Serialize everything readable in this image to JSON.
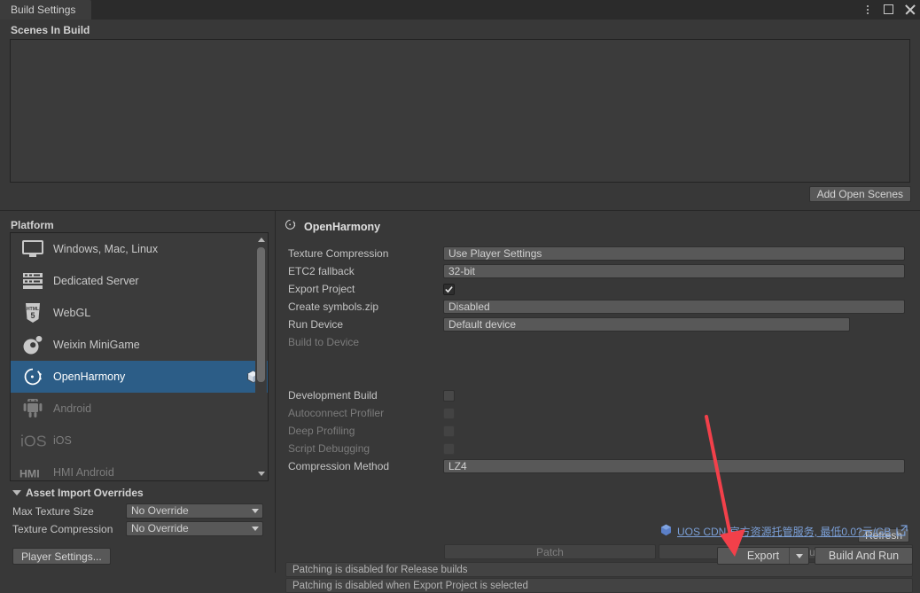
{
  "window": {
    "tab_label": "Build Settings",
    "menu_icon": "kebab-menu-icon",
    "maximize_icon": "maximize-icon",
    "close_icon": "close-icon"
  },
  "scenes": {
    "title": "Scenes In Build",
    "items": [],
    "add_open_scenes_label": "Add Open Scenes"
  },
  "platform": {
    "title": "Platform",
    "items": [
      {
        "label": "Windows, Mac, Linux",
        "icon": "desktop-icon",
        "selected": false,
        "installed": true
      },
      {
        "label": "Dedicated Server",
        "icon": "server-icon",
        "selected": false,
        "installed": true
      },
      {
        "label": "WebGL",
        "icon": "html5-icon",
        "selected": false,
        "installed": true
      },
      {
        "label": "Weixin MiniGame",
        "icon": "weixin-minigame-icon",
        "selected": false,
        "installed": true
      },
      {
        "label": "OpenHarmony",
        "icon": "openharmony-icon",
        "selected": true,
        "installed": true,
        "badge": "download-badge-icon"
      },
      {
        "label": "Android",
        "icon": "android-icon",
        "selected": false,
        "installed": false
      },
      {
        "label": "iOS",
        "icon": "ios-icon",
        "selected": false,
        "installed": false
      },
      {
        "label": "HMI Android",
        "icon": "hmi-icon",
        "selected": false,
        "installed": false
      }
    ]
  },
  "asset_import_overrides": {
    "title": "Asset Import Overrides",
    "rows": [
      {
        "label": "Max Texture Size",
        "value": "No Override"
      },
      {
        "label": "Texture Compression",
        "value": "No Override"
      }
    ],
    "player_settings_label": "Player Settings..."
  },
  "settings": {
    "header": "OpenHarmony",
    "header_icon": "openharmony-icon",
    "texture_compression": {
      "label": "Texture Compression",
      "value": "Use Player Settings"
    },
    "etc2_fallback": {
      "label": "ETC2 fallback",
      "value": "32-bit"
    },
    "export_project": {
      "label": "Export Project",
      "checked": true
    },
    "create_symbols": {
      "label": "Create symbols.zip",
      "value": "Disabled"
    },
    "run_device": {
      "label": "Run Device",
      "value": "Default device",
      "refresh_label": "Refresh"
    },
    "build_to_device": {
      "label": "Build to Device",
      "patch_label": "Patch",
      "patch_and_run_label": "Patch And Run"
    },
    "help_1": "Patching is disabled for Release builds",
    "help_2": "Patching is disabled when Export Project is selected",
    "development_build": {
      "label": "Development Build",
      "checked": false,
      "disabled": false
    },
    "autoconnect_profiler": {
      "label": "Autoconnect Profiler",
      "checked": false,
      "disabled": true
    },
    "deep_profiling": {
      "label": "Deep Profiling",
      "checked": false,
      "disabled": true
    },
    "script_debugging": {
      "label": "Script Debugging",
      "checked": false,
      "disabled": true
    },
    "compression_method": {
      "label": "Compression Method",
      "value": "LZ4"
    }
  },
  "footer": {
    "cdn_link_text": "UOS CDN 官方资源托管服务, 最低0.0?元/GB",
    "cdn_icon": "uos-cube-icon",
    "external_link_icon": "external-link-icon",
    "export_label": "Export",
    "export_dropdown_icon": "chevron-down-icon",
    "build_and_run_label": "Build And Run"
  },
  "annotation": {
    "arrow_color": "#f2404a",
    "arrow_name": "red-pointer-arrow"
  }
}
